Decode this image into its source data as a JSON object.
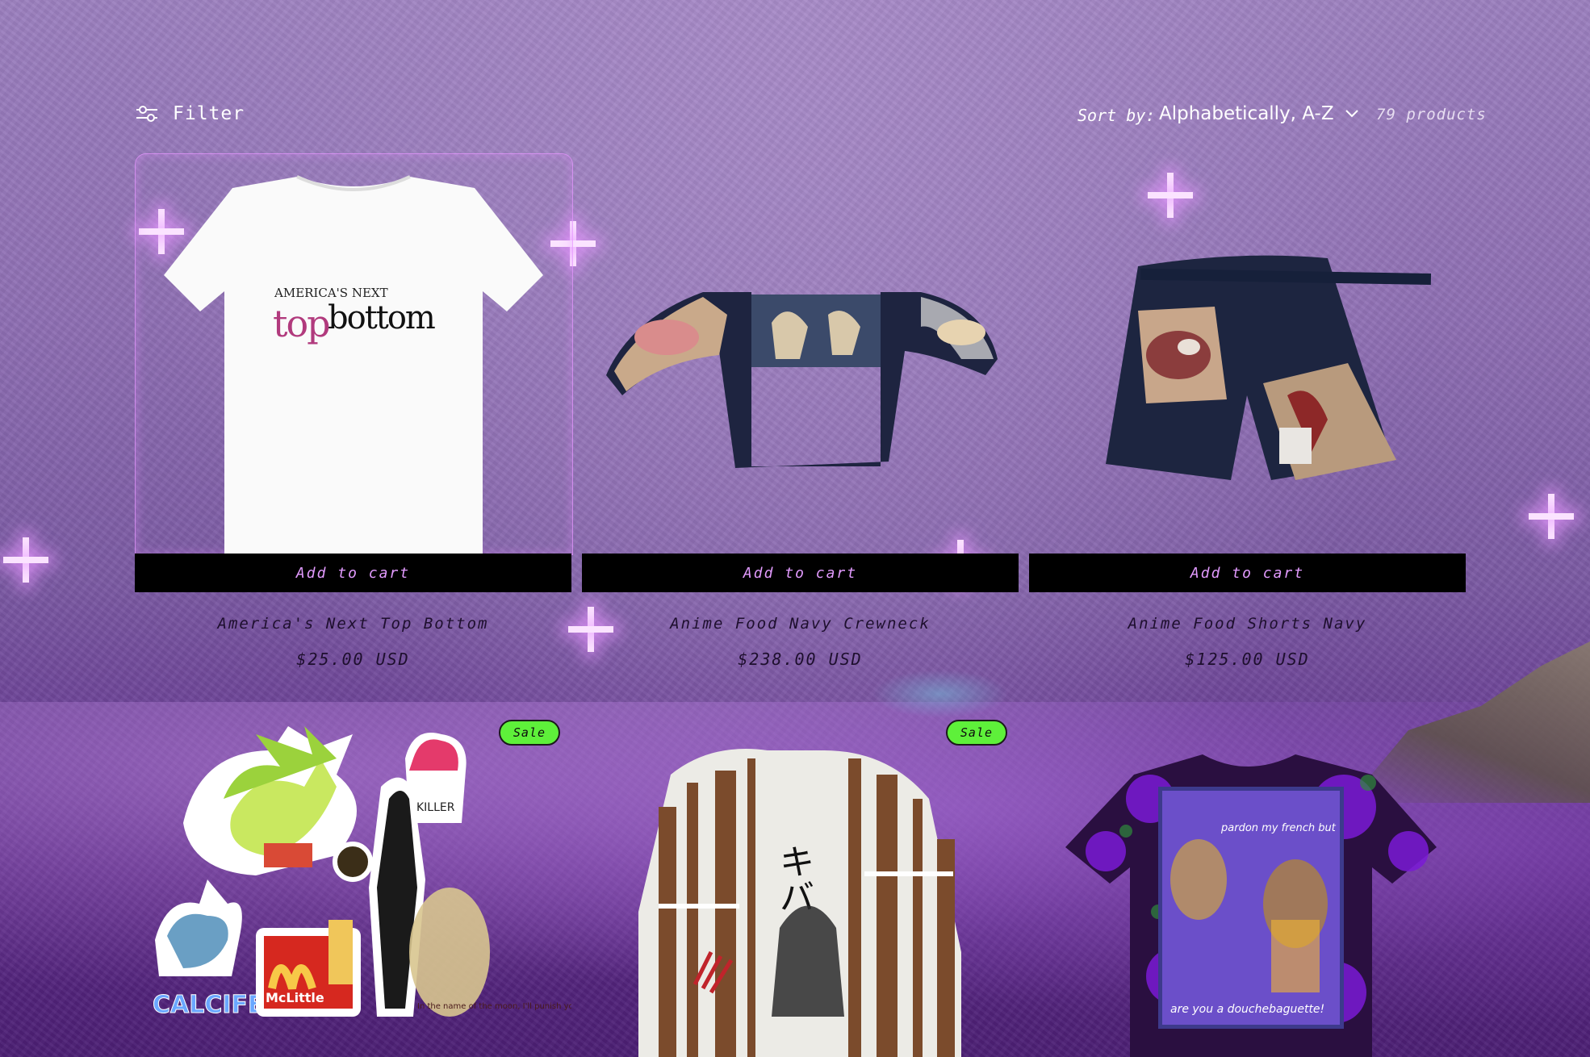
{
  "toolbar": {
    "filter_label": "Filter",
    "sort_label": "Sort by:",
    "sort_value": "Alphabetically, A-Z",
    "product_count": "79 products"
  },
  "products": [
    {
      "title": "America's Next Top Bottom",
      "price": "$25.00 USD",
      "add_to_cart": "Add to cart",
      "shirt_text_small": "AMERICA'S NEXT",
      "shirt_text_pink": "top",
      "shirt_text_black": "bottom"
    },
    {
      "title": "Anime Food Navy Crewneck",
      "price": "$238.00 USD",
      "add_to_cart": "Add to cart"
    },
    {
      "title": "Anime Food Shorts Navy",
      "price": "$125.00 USD",
      "add_to_cart": "Add to cart"
    }
  ],
  "products_row2": [
    {
      "badge": "Sale",
      "sticker_texts": [
        "KILLER",
        "McLittle",
        "In the name of the moon, I'll punish you!",
        "CALCIFER"
      ]
    },
    {
      "badge": "Sale",
      "shirt_glyphs": "キバ"
    },
    {
      "shirt_texts": [
        "pardon my french but",
        "are you a douchebaguette!"
      ]
    }
  ],
  "colors": {
    "accent_pink": "#e39bff",
    "sale_green": "#5ef03a",
    "text_dark": "#1e0f2e"
  }
}
